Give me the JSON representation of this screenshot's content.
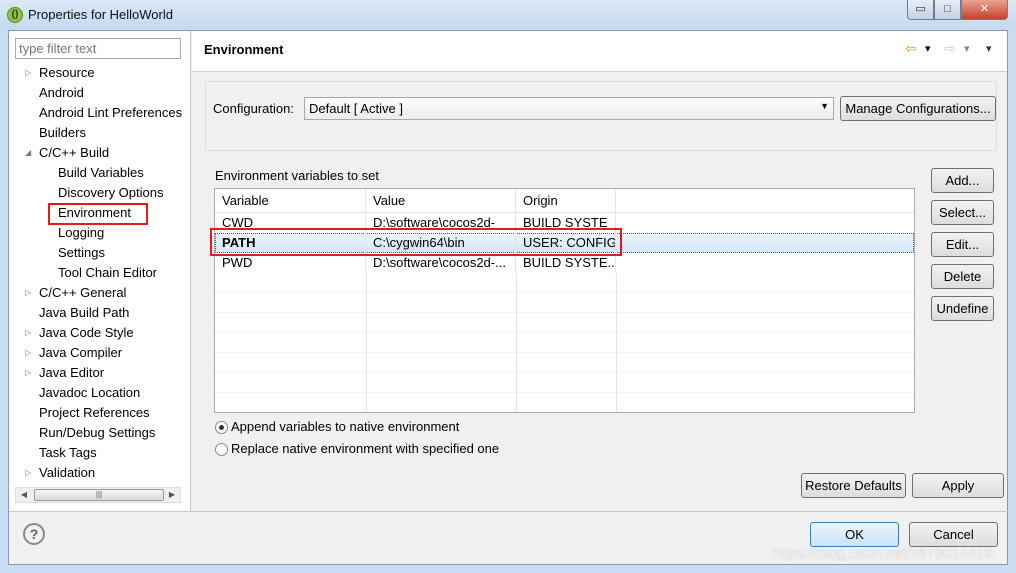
{
  "window": {
    "title": "Properties for HelloWorld",
    "minimize": "▭",
    "maximize": "□",
    "close": "✕"
  },
  "filter": {
    "placeholder": "type filter text"
  },
  "tree": [
    {
      "label": "Resource",
      "expandable": true,
      "level": 0
    },
    {
      "label": "Android",
      "expandable": false,
      "level": 0
    },
    {
      "label": "Android Lint Preferences",
      "expandable": false,
      "level": 0
    },
    {
      "label": "Builders",
      "expandable": false,
      "level": 0
    },
    {
      "label": "C/C++ Build",
      "expandable": true,
      "expanded": true,
      "level": 0
    },
    {
      "label": "Build Variables",
      "level": 1
    },
    {
      "label": "Discovery Options",
      "level": 1
    },
    {
      "label": "Environment",
      "level": 1,
      "selected": true
    },
    {
      "label": "Logging",
      "level": 1
    },
    {
      "label": "Settings",
      "level": 1
    },
    {
      "label": "Tool Chain Editor",
      "level": 1
    },
    {
      "label": "C/C++ General",
      "expandable": true,
      "level": 0
    },
    {
      "label": "Java Build Path",
      "level": 0
    },
    {
      "label": "Java Code Style",
      "expandable": true,
      "level": 0
    },
    {
      "label": "Java Compiler",
      "expandable": true,
      "level": 0
    },
    {
      "label": "Java Editor",
      "expandable": true,
      "level": 0
    },
    {
      "label": "Javadoc Location",
      "level": 0
    },
    {
      "label": "Project References",
      "level": 0
    },
    {
      "label": "Run/Debug Settings",
      "level": 0
    },
    {
      "label": "Task Tags",
      "level": 0
    },
    {
      "label": "Validation",
      "expandable": true,
      "level": 0
    }
  ],
  "page": {
    "title": "Environment",
    "nav": {
      "back": "⇦",
      "back_menu": "▾",
      "forward": "⇨",
      "forward_menu": "▾",
      "view_menu": "▾"
    }
  },
  "configuration": {
    "label": "Configuration:",
    "value": "Default  [ Active ]",
    "manage": "Manage Configurations..."
  },
  "env": {
    "label": "Environment variables to set",
    "columns": [
      "Variable",
      "Value",
      "Origin"
    ],
    "rows": [
      {
        "variable": "CWD",
        "value": "D:\\software\\cocos2d-",
        "origin": "BUILD SYSTE"
      },
      {
        "variable": "PATH",
        "value": "C:\\cygwin64\\bin",
        "origin": "USER: CONFIG",
        "selected": true
      },
      {
        "variable": "PWD",
        "value": "D:\\software\\cocos2d-...",
        "origin": "BUILD SYSTE..."
      }
    ],
    "buttons": {
      "add": "Add...",
      "select": "Select...",
      "edit": "Edit...",
      "delete": "Delete",
      "undefine": "Undefine"
    }
  },
  "mode": {
    "append": "Append variables to native environment",
    "replace": "Replace native environment with specified one",
    "selected": "append"
  },
  "footer": {
    "restore": "Restore Defaults",
    "apply": "Apply",
    "ok": "OK",
    "cancel": "Cancel",
    "help": "?"
  },
  "watermark": "https://blog.csdn.net/x879014419"
}
